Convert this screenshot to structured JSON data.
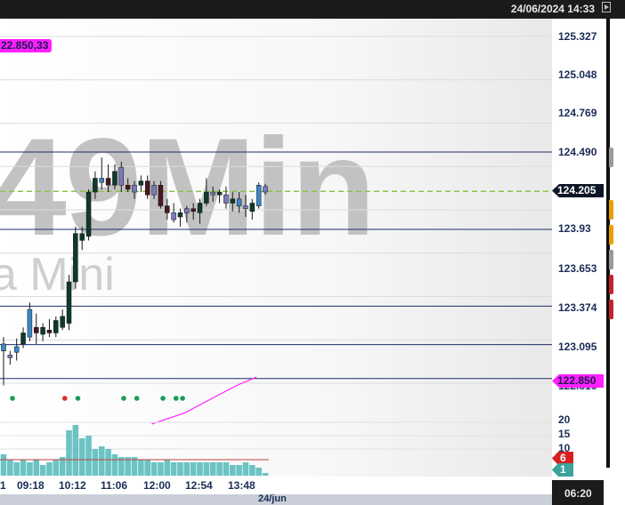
{
  "topbar": {
    "datetime": "24/06/2024 14:33"
  },
  "watermark": {
    "big": "49Min",
    "small": "a Mini"
  },
  "badge_topleft": "22.850,33",
  "price_axis": {
    "ticks": [
      "125.327",
      "125.048",
      "124.769",
      "124.490",
      "123.93",
      "123.653",
      "123.374",
      "123.095",
      "122.816"
    ],
    "current_price": "124.205",
    "magenta_price": "122.850"
  },
  "volume_axis": {
    "ticks": [
      "20",
      "15",
      "10"
    ],
    "red_value": "6",
    "teal_value": "1"
  },
  "time_axis": {
    "ticks": [
      "1",
      "09:18",
      "10:12",
      "11:06",
      "12:00",
      "12:54",
      "13:48"
    ],
    "date": "24/jun"
  },
  "clock": "06:20",
  "colors": {
    "background": "#ffffff",
    "topbar": "#1b1b1b",
    "axis_text": "#1a2c55",
    "candle_dark_up": "#0e3a2c",
    "candle_dark_down": "#4a1620",
    "candle_blue": "#3d86c6",
    "candle_purple": "#7a7ac0",
    "volume_teal": "#5cbdbd",
    "magenta": "#ff1fff",
    "dash_green": "#8bc34a",
    "dot_green": "#1a9a5a",
    "dot_red": "#d63030"
  },
  "chart_data": {
    "type": "candlestick",
    "price_range": [
      122.74,
      125.4
    ],
    "horizontal_levels": [
      124.49,
      123.93,
      123.374,
      123.095,
      122.85
    ],
    "dashed_level": 124.205,
    "candles": [
      {
        "o": 123.05,
        "h": 123.15,
        "l": 122.8,
        "c": 123.1,
        "color": "blue"
      },
      {
        "o": 123.02,
        "h": 123.05,
        "l": 122.95,
        "c": 123.0,
        "color": "purple"
      },
      {
        "o": 123.08,
        "h": 123.14,
        "l": 122.98,
        "c": 123.04,
        "color": "blue"
      },
      {
        "o": 123.1,
        "h": 123.22,
        "l": 123.07,
        "c": 123.18,
        "color": "dark-up"
      },
      {
        "o": 123.15,
        "h": 123.4,
        "l": 123.12,
        "c": 123.35,
        "color": "blue"
      },
      {
        "o": 123.22,
        "h": 123.32,
        "l": 123.1,
        "c": 123.18,
        "color": "dark-down"
      },
      {
        "o": 123.17,
        "h": 123.25,
        "l": 123.12,
        "c": 123.22,
        "color": "dark-up"
      },
      {
        "o": 123.2,
        "h": 123.28,
        "l": 123.15,
        "c": 123.18,
        "color": "dark-down"
      },
      {
        "o": 123.18,
        "h": 123.3,
        "l": 123.15,
        "c": 123.27,
        "color": "dark-up"
      },
      {
        "o": 123.22,
        "h": 123.35,
        "l": 123.2,
        "c": 123.3,
        "color": "dark-up"
      },
      {
        "o": 123.25,
        "h": 123.6,
        "l": 123.2,
        "c": 123.55,
        "color": "dark-up"
      },
      {
        "o": 123.55,
        "h": 123.95,
        "l": 123.5,
        "c": 123.9,
        "color": "dark-up"
      },
      {
        "o": 123.85,
        "h": 123.95,
        "l": 123.78,
        "c": 123.9,
        "color": "dark-up"
      },
      {
        "o": 123.88,
        "h": 124.22,
        "l": 123.85,
        "c": 124.2,
        "color": "dark-up"
      },
      {
        "o": 124.2,
        "h": 124.35,
        "l": 124.15,
        "c": 124.3,
        "color": "dark-up"
      },
      {
        "o": 124.3,
        "h": 124.45,
        "l": 124.22,
        "c": 124.27,
        "color": "blue"
      },
      {
        "o": 124.3,
        "h": 124.4,
        "l": 124.2,
        "c": 124.25,
        "color": "dark-down"
      },
      {
        "o": 124.25,
        "h": 124.4,
        "l": 124.22,
        "c": 124.35,
        "color": "dark-up"
      },
      {
        "o": 124.38,
        "h": 124.42,
        "l": 124.2,
        "c": 124.25,
        "color": "purple"
      },
      {
        "o": 124.25,
        "h": 124.3,
        "l": 124.2,
        "c": 124.22,
        "color": "dark-down"
      },
      {
        "o": 124.2,
        "h": 124.28,
        "l": 124.15,
        "c": 124.25,
        "color": "purple"
      },
      {
        "o": 124.28,
        "h": 124.32,
        "l": 124.2,
        "c": 124.25,
        "color": "dark-up"
      },
      {
        "o": 124.28,
        "h": 124.32,
        "l": 124.15,
        "c": 124.18,
        "color": "dark-down"
      },
      {
        "o": 124.18,
        "h": 124.28,
        "l": 124.15,
        "c": 124.25,
        "color": "purple"
      },
      {
        "o": 124.25,
        "h": 124.28,
        "l": 124.08,
        "c": 124.1,
        "color": "dark-down"
      },
      {
        "o": 124.1,
        "h": 124.15,
        "l": 124.0,
        "c": 124.05,
        "color": "dark-down"
      },
      {
        "o": 124.05,
        "h": 124.12,
        "l": 123.98,
        "c": 124.0,
        "color": "purple"
      },
      {
        "o": 124.02,
        "h": 124.08,
        "l": 123.95,
        "c": 124.05,
        "color": "dark-up"
      },
      {
        "o": 124.05,
        "h": 124.1,
        "l": 123.98,
        "c": 124.08,
        "color": "purple"
      },
      {
        "o": 124.08,
        "h": 124.12,
        "l": 124.0,
        "c": 124.06,
        "color": "dark-down"
      },
      {
        "o": 124.05,
        "h": 124.15,
        "l": 123.97,
        "c": 124.12,
        "color": "dark-up"
      },
      {
        "o": 124.12,
        "h": 124.3,
        "l": 124.1,
        "c": 124.2,
        "color": "dark-up"
      },
      {
        "o": 124.2,
        "h": 124.24,
        "l": 124.13,
        "c": 124.18,
        "color": "purple"
      },
      {
        "o": 124.18,
        "h": 124.22,
        "l": 124.12,
        "c": 124.2,
        "color": "dark-up"
      },
      {
        "o": 124.18,
        "h": 124.24,
        "l": 124.08,
        "c": 124.12,
        "color": "purple"
      },
      {
        "o": 124.12,
        "h": 124.2,
        "l": 124.06,
        "c": 124.15,
        "color": "dark-up"
      },
      {
        "o": 124.15,
        "h": 124.2,
        "l": 124.05,
        "c": 124.1,
        "color": "blue"
      },
      {
        "o": 124.1,
        "h": 124.18,
        "l": 124.02,
        "c": 124.08,
        "color": "purple"
      },
      {
        "o": 124.06,
        "h": 124.15,
        "l": 124.0,
        "c": 124.12,
        "color": "dark-up"
      },
      {
        "o": 124.1,
        "h": 124.27,
        "l": 124.08,
        "c": 124.25,
        "color": "blue"
      },
      {
        "o": 124.2,
        "h": 124.26,
        "l": 124.18,
        "c": 124.24,
        "color": "purple"
      }
    ],
    "signal_dots": [
      {
        "candle": 8,
        "color": "red"
      },
      {
        "candle": 10,
        "color": "green"
      },
      {
        "candle": 17,
        "color": "green"
      },
      {
        "candle": 19,
        "color": "green"
      },
      {
        "candle": 23,
        "color": "green"
      },
      {
        "candle": 25,
        "color": "green"
      },
      {
        "candle": 26,
        "color": "green"
      },
      {
        "candle": 0,
        "color": "green"
      }
    ],
    "magenta_line": [
      [
        21,
        122.52
      ],
      [
        26,
        122.6
      ],
      [
        30,
        122.7
      ],
      [
        34,
        122.8
      ],
      [
        37,
        122.86
      ]
    ],
    "volume": [
      8,
      6,
      5,
      6,
      5,
      6,
      4,
      5,
      6,
      7,
      17,
      19,
      14,
      15,
      10,
      11,
      10,
      8,
      7,
      7,
      7,
      6,
      6,
      5,
      5,
      6,
      5,
      5,
      5,
      5,
      5,
      5,
      5,
      5,
      5,
      4,
      4,
      5,
      4,
      3,
      1
    ],
    "volume_avg": 6,
    "volume_range": [
      0,
      24
    ]
  }
}
